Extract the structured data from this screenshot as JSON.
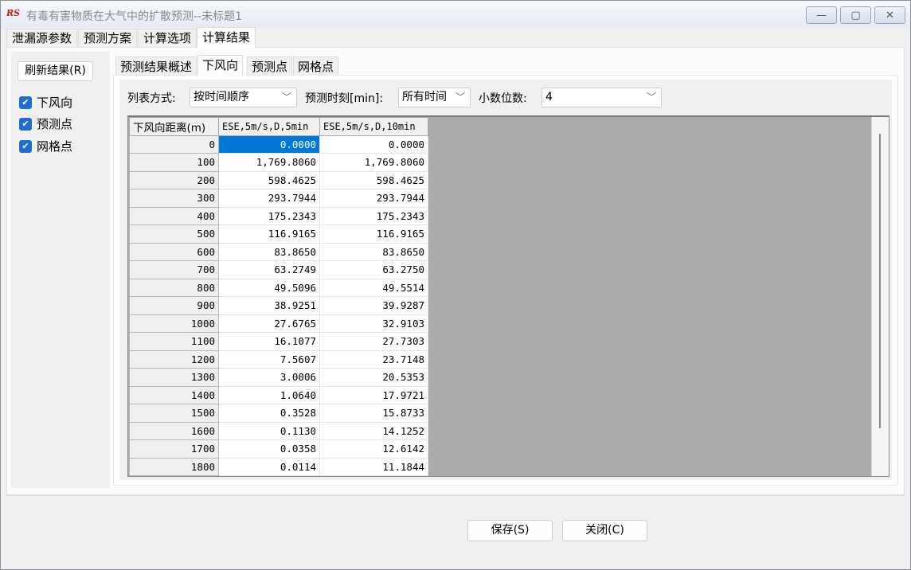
{
  "window": {
    "logo": "RS",
    "title": "有毒有害物质在大气中的扩散预测--未标题1",
    "minimize": "—",
    "maximize": "▢",
    "close": "✕"
  },
  "tabs": [
    "泄漏源参数",
    "预测方案",
    "计算选项",
    "计算结果"
  ],
  "left": {
    "refresh": "刷新结果(R)",
    "checks": [
      {
        "label": "下风向",
        "checked": true
      },
      {
        "label": "预测点",
        "checked": true
      },
      {
        "label": "网格点",
        "checked": true
      }
    ]
  },
  "inner_tabs": [
    "预测结果概述",
    "下风向",
    "预测点",
    "网格点"
  ],
  "toolbar": {
    "list_label": "列表方式:",
    "list_value": "按时间顺序",
    "time_label": "预测时刻[min]:",
    "time_value": "所有时间",
    "decimal_label": "小数位数:",
    "decimal_value": "4"
  },
  "table": {
    "headers": [
      "下风向距离(m)",
      "ESE,5m/s,D,5min",
      "ESE,5m/s,D,10min"
    ],
    "rows": [
      [
        "0",
        "0.0000",
        "0.0000"
      ],
      [
        "100",
        "1,769.8060",
        "1,769.8060"
      ],
      [
        "200",
        "598.4625",
        "598.4625"
      ],
      [
        "300",
        "293.7944",
        "293.7944"
      ],
      [
        "400",
        "175.2343",
        "175.2343"
      ],
      [
        "500",
        "116.9165",
        "116.9165"
      ],
      [
        "600",
        "83.8650",
        "83.8650"
      ],
      [
        "700",
        "63.2749",
        "63.2750"
      ],
      [
        "800",
        "49.5096",
        "49.5514"
      ],
      [
        "900",
        "38.9251",
        "39.9287"
      ],
      [
        "1000",
        "27.6765",
        "32.9103"
      ],
      [
        "1100",
        "16.1077",
        "27.7303"
      ],
      [
        "1200",
        "7.5607",
        "23.7148"
      ],
      [
        "1300",
        "3.0006",
        "20.5353"
      ],
      [
        "1400",
        "1.0640",
        "17.9721"
      ],
      [
        "1500",
        "0.3528",
        "15.8733"
      ],
      [
        "1600",
        "0.1130",
        "14.1252"
      ],
      [
        "1700",
        "0.0358",
        "12.6142"
      ],
      [
        "1800",
        "0.0114",
        "11.1844"
      ]
    ]
  },
  "buttons": {
    "save": "保存(S)",
    "close": "关闭(C)"
  }
}
